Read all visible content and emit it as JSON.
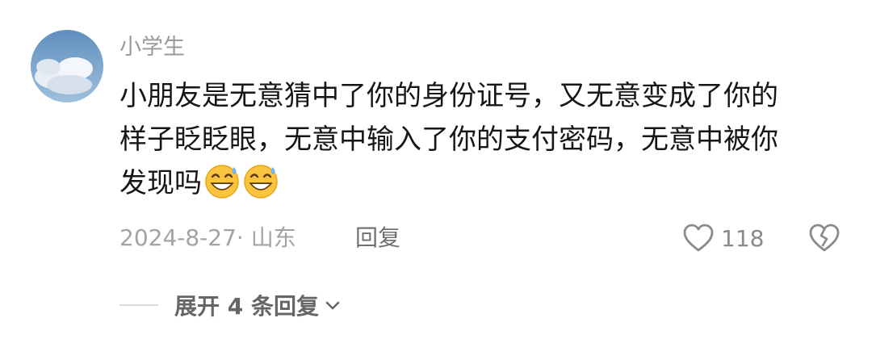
{
  "comment": {
    "username": "小学生",
    "text_lines": [
      "小朋友是无意猜中了你的身份证号，又无意变成了你的",
      "样子眨眨眼，无意中输入了你的支付密码，无意中被你",
      "发现吗"
    ],
    "emojis": [
      "grinning-sweat-emoji",
      "grinning-sweat-emoji"
    ],
    "date_location": "2024-8-27· 山东",
    "reply_label": "回复",
    "like_count": "118",
    "expand_replies_label": "展开 4 条回复"
  },
  "icons": {
    "like": "heart-outline-icon",
    "dislike": "broken-heart-icon",
    "expand": "chevron-down-icon"
  },
  "colors": {
    "text": "#161616",
    "muted": "#a3a3a3",
    "secondary": "#6f6f6f"
  }
}
